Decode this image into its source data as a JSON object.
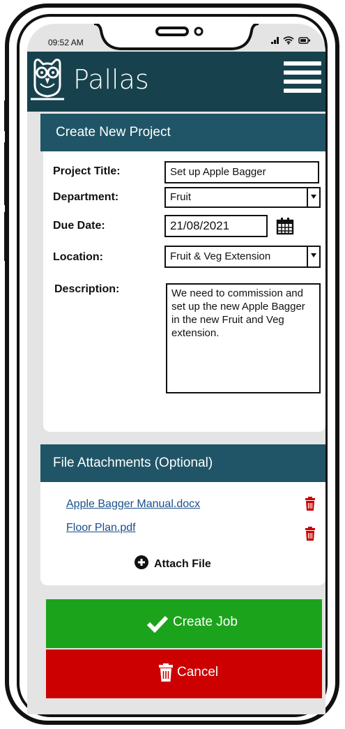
{
  "status_bar": {
    "time": "09:52 AM",
    "icons": "signal wifi battery"
  },
  "header": {
    "app_title": "Pallas",
    "logo_icon": "owl-icon",
    "menu_icon": "hamburger-menu-icon"
  },
  "project_card": {
    "heading": "Create New Project",
    "fields": {
      "title": {
        "label": "Project Title:",
        "value": "Set up Apple Bagger"
      },
      "department": {
        "label": "Department:",
        "value": "Fruit"
      },
      "due_date": {
        "label": "Due Date:",
        "value": "21/08/2021",
        "icon": "calendar-icon"
      },
      "location": {
        "label": "Location:",
        "value": "Fruit & Veg Extension"
      },
      "description": {
        "label": "Description:",
        "value": "We need to commission and set up the new Apple Bagger in the new Fruit and Veg extension."
      }
    }
  },
  "attachments_card": {
    "heading": "File Attachments (Optional)",
    "files": [
      {
        "name": "Apple Bagger Manual.docx"
      },
      {
        "name": "Floor Plan.pdf"
      }
    ],
    "attach_label": "Attach File"
  },
  "actions": {
    "create_label": "Create Job",
    "cancel_label": "Cancel"
  },
  "colors": {
    "header": "#17424d",
    "card_heading": "#1f5566",
    "create": "#1ca31c",
    "cancel": "#cc0000",
    "delete_icon": "#cc0000",
    "link": "#1a4f8a"
  }
}
